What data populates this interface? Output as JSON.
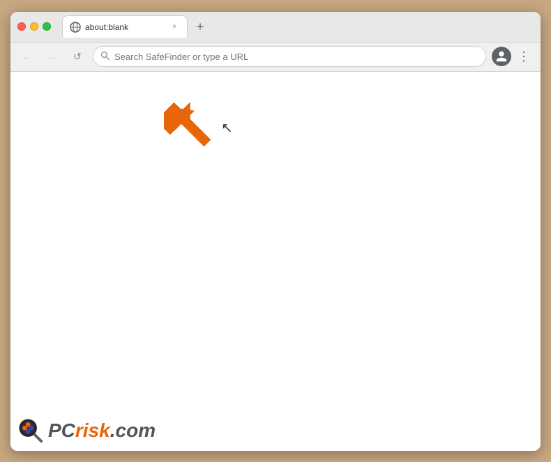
{
  "browser": {
    "tab": {
      "title": "about:blank",
      "favicon_label": "page-icon"
    },
    "new_tab_label": "+",
    "close_tab_label": "×",
    "nav": {
      "back_label": "←",
      "forward_label": "→",
      "reload_label": "↺"
    },
    "address_bar": {
      "placeholder": "Search SafeFinder or type a URL",
      "value": ""
    },
    "account_icon_label": "👤",
    "menu_icon_label": "⋮"
  },
  "page": {
    "background_color": "#ffffff"
  },
  "watermark": {
    "pc_text": "PC",
    "risk_text": "risk",
    "domain": ".com"
  },
  "arrow": {
    "color": "#e8650a",
    "direction": "upper-left"
  },
  "colors": {
    "tab_bg": "#ffffff",
    "toolbar_bg": "#f0f0f0",
    "address_bar_bg": "#ffffff",
    "browser_bg": "#e8e8e8",
    "page_bg": "#ffffff",
    "outer_bg": "#c8a882",
    "arrow_color": "#e8650a",
    "pcrisk_orange": "#e8650a",
    "pcrisk_gray": "#555555"
  }
}
